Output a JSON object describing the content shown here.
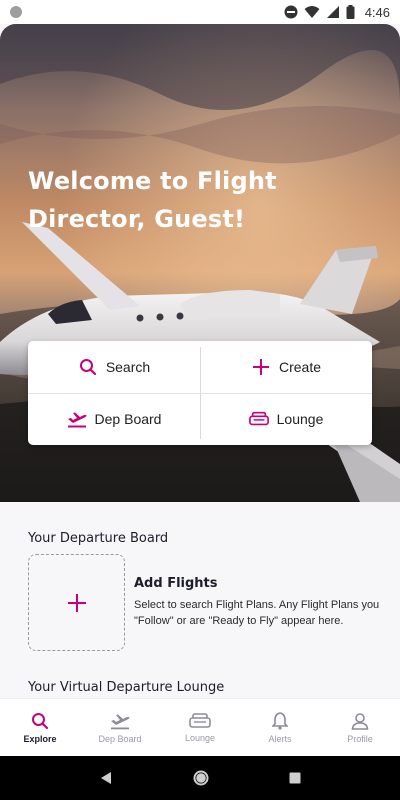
{
  "status_bar": {
    "time": "4:46"
  },
  "hero": {
    "title": "Welcome to Flight Director, Guest!"
  },
  "actions": [
    {
      "label": "Search",
      "icon": "search-icon"
    },
    {
      "label": "Create",
      "icon": "plus-icon"
    },
    {
      "label": "Dep Board",
      "icon": "departure-icon"
    },
    {
      "label": "Lounge",
      "icon": "sofa-icon"
    }
  ],
  "departure_board": {
    "title": "Your Departure Board",
    "add_title": "Add Flights",
    "add_description": "Select to search Flight Plans. Any Flight Plans you \"Follow\" or are \"Ready to Fly\" appear here."
  },
  "lounge": {
    "title": "Your Virtual Departure Lounge"
  },
  "bottom_nav": [
    {
      "label": "Explore",
      "icon": "search-icon",
      "active": true
    },
    {
      "label": "Dep Board",
      "icon": "departure-icon",
      "active": false
    },
    {
      "label": "Lounge",
      "icon": "sofa-icon",
      "active": false
    },
    {
      "label": "Alerts",
      "icon": "bell-icon",
      "active": false
    },
    {
      "label": "Profile",
      "icon": "user-icon",
      "active": false
    }
  ],
  "colors": {
    "accent": "#c8007a",
    "inactive": "#9a9aa4",
    "text": "#1d1d2b"
  }
}
